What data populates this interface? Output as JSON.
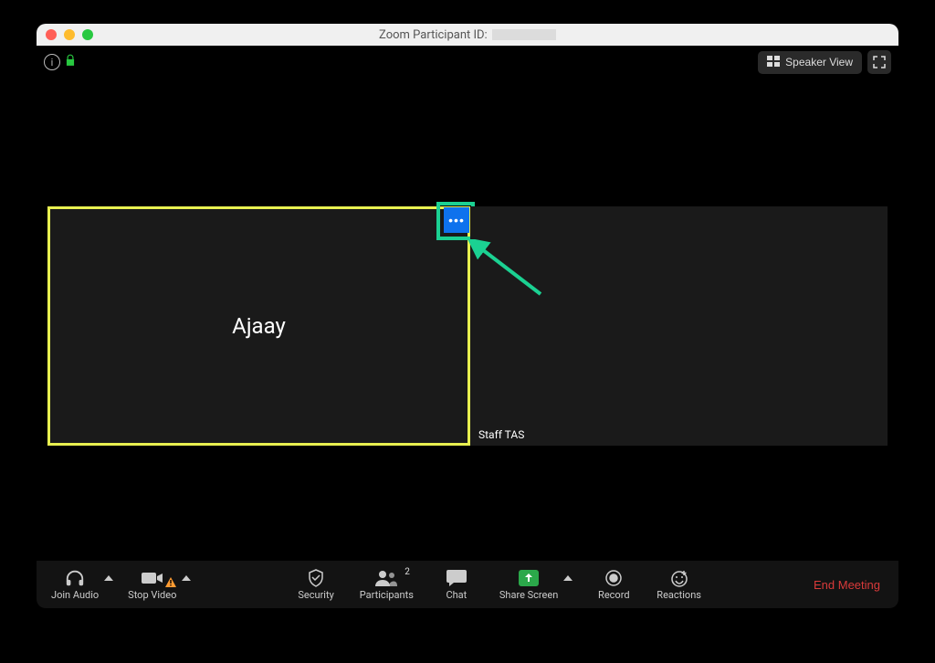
{
  "titlebar": {
    "title": "Zoom Participant ID:"
  },
  "top": {
    "speaker_view_label": "Speaker View"
  },
  "participants": {
    "active_name": "Ajaay",
    "other_name": "Staff TAS"
  },
  "toolbar": {
    "join_audio": "Join Audio",
    "stop_video": "Stop Video",
    "security": "Security",
    "participants": "Participants",
    "participants_count": "2",
    "chat": "Chat",
    "share_screen": "Share Screen",
    "record": "Record",
    "reactions": "Reactions",
    "end_meeting": "End Meeting"
  }
}
